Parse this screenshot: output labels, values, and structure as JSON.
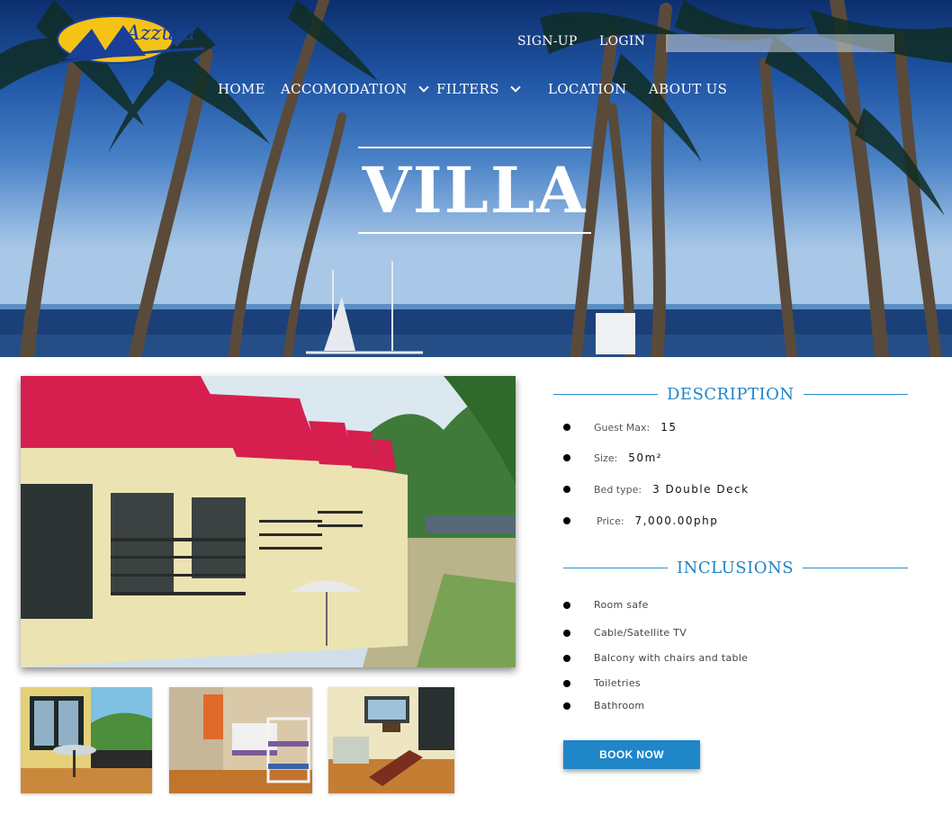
{
  "brand": {
    "logo_text": "Azzura"
  },
  "topnav": {
    "signup": "SIGN-UP",
    "login": "LOGIN",
    "search_placeholder": ""
  },
  "mainnav": {
    "home": "HOME",
    "accomodation": "ACCOMODATION",
    "filters": "FILTERS",
    "location": "LOCATION",
    "about": "ABOUT US"
  },
  "hero": {
    "title": "VILLA"
  },
  "description": {
    "heading": "DESCRIPTION",
    "rows": [
      {
        "label": "Guest Max:",
        "value": "15"
      },
      {
        "label": "Size:",
        "value": "50m²"
      },
      {
        "label": "Bed type:",
        "value": "3 Double Deck"
      },
      {
        "label": "Price:",
        "value": "7,000.00php"
      }
    ]
  },
  "inclusions": {
    "heading": "INCLUSIONS",
    "items": [
      "Room safe",
      "Cable/Satellite TV",
      "Balcony with chairs and table",
      "Toiletries",
      "Bathroom"
    ]
  },
  "actions": {
    "book_now": "BOOK NOW"
  },
  "colors": {
    "accent": "#1f83c4",
    "button": "#1f86c8",
    "roof": "#d61f4e"
  },
  "icons": [
    "chevron-down-icon",
    "logo-icon"
  ]
}
